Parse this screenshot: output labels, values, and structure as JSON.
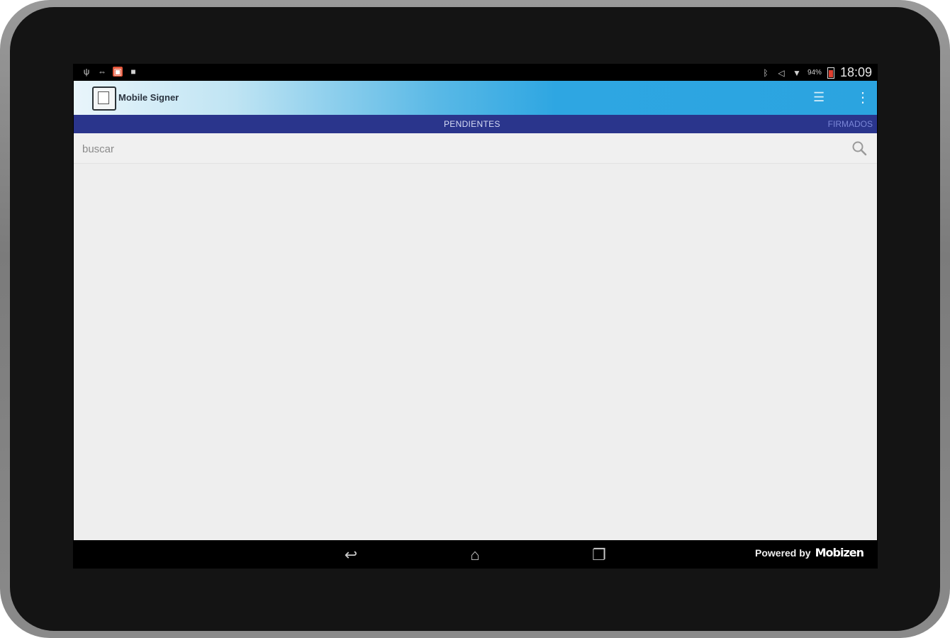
{
  "status_bar": {
    "left_icons": [
      "usb-icon",
      "transfer-icon",
      "notification-icon",
      "video-icon"
    ],
    "battery_percent": "94%",
    "time": "18:09"
  },
  "action_bar": {
    "app_title": "Mobile Signer"
  },
  "tabs": {
    "pending": "PENDIENTES",
    "signed": "FIRMADOS"
  },
  "search": {
    "placeholder": "buscar"
  },
  "footer": {
    "powered_by": "Powered by",
    "brand": "Mobizen"
  },
  "colors": {
    "tab_bar": "#2a358c",
    "action_bar_accent": "#2ba4e0",
    "content_bg": "#eeeeee"
  }
}
